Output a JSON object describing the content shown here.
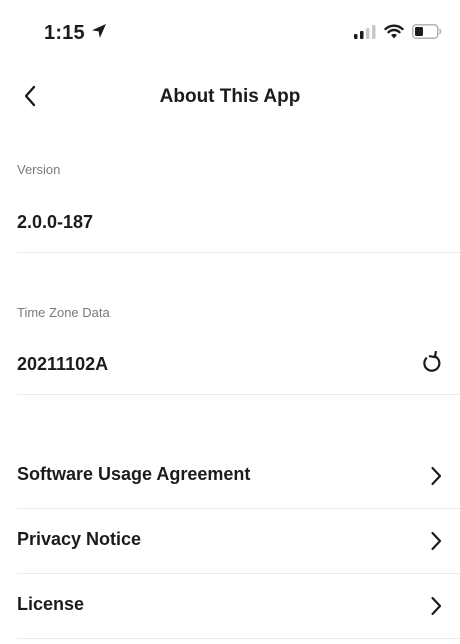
{
  "status_bar": {
    "time": "1:15",
    "location_icon": "location-arrow-icon",
    "signal_icon": "cellular-signal-icon",
    "wifi_icon": "wifi-icon",
    "battery_icon": "battery-icon"
  },
  "nav": {
    "back_icon": "chevron-left-icon",
    "title": "About This App"
  },
  "version": {
    "label": "Version",
    "value": "2.0.0-187"
  },
  "time_zone": {
    "label": "Time Zone Data",
    "value": "20211102A",
    "refresh_icon": "refresh-icon"
  },
  "menu": [
    {
      "label": "Software Usage Agreement",
      "icon": "chevron-right-icon"
    },
    {
      "label": "Privacy Notice",
      "icon": "chevron-right-icon"
    },
    {
      "label": "License",
      "icon": "chevron-right-icon"
    }
  ],
  "colors": {
    "text": "#1c1c1e",
    "secondary_text": "#7a7a7e",
    "divider": "#ebebed",
    "background": "#ffffff"
  }
}
